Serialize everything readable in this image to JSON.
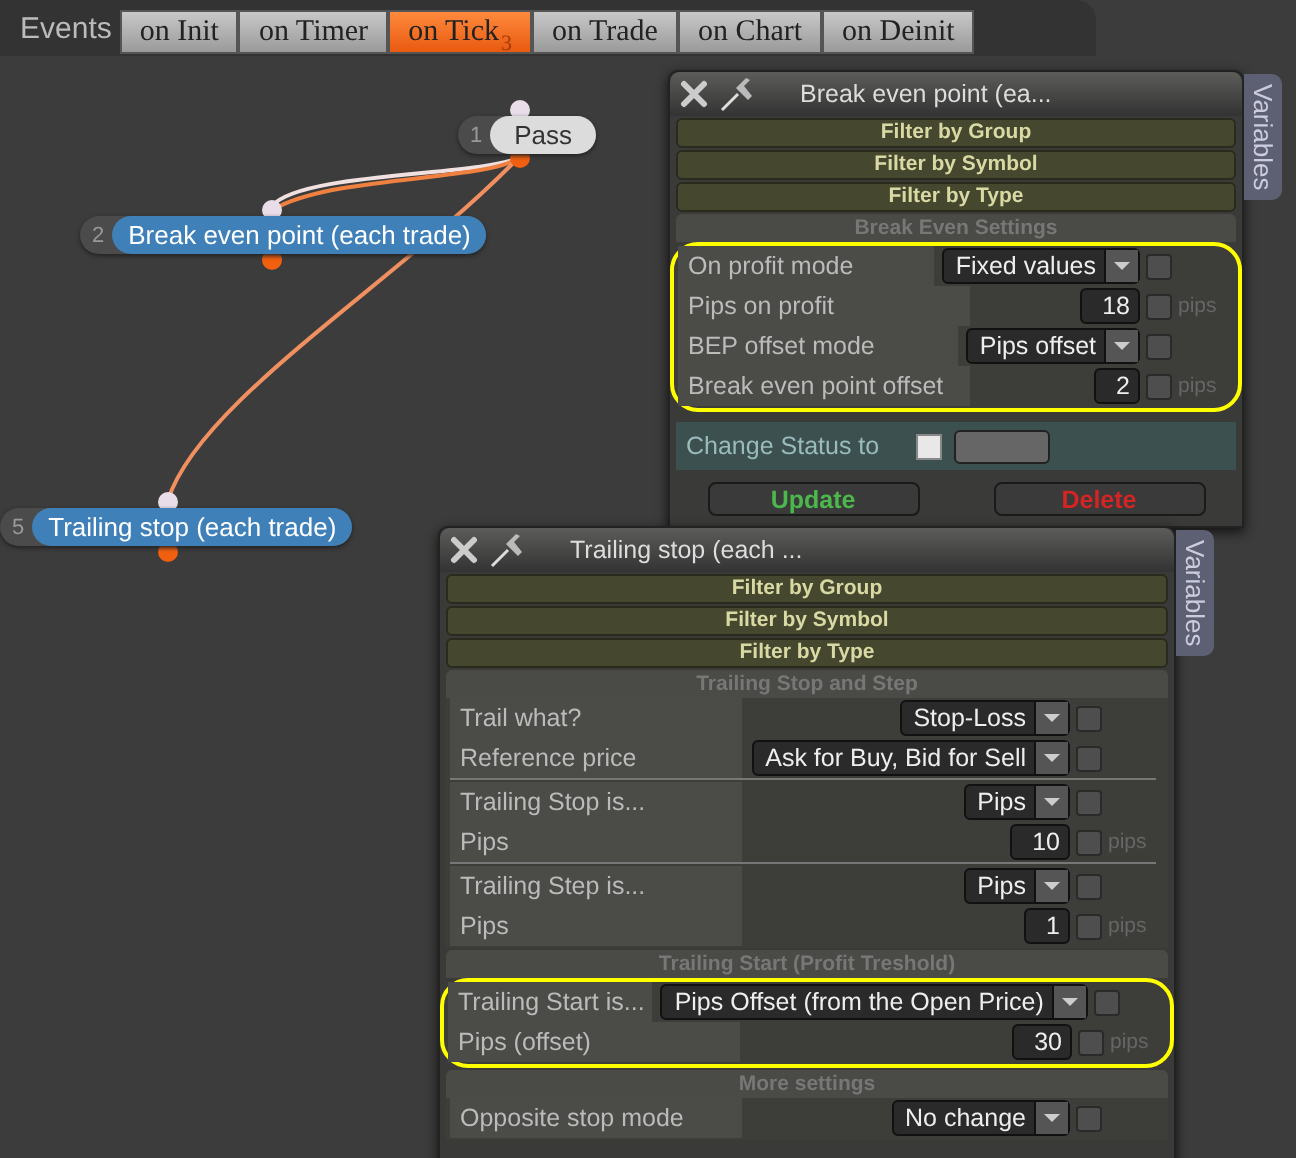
{
  "events": {
    "label": "Events",
    "tabs": [
      {
        "label": "on Init",
        "selected": false
      },
      {
        "label": "on Timer",
        "selected": false
      },
      {
        "label": "on Tick",
        "selected": true,
        "badge": "3"
      },
      {
        "label": "on Trade",
        "selected": false
      },
      {
        "label": "on Chart",
        "selected": false
      },
      {
        "label": "on Deinit",
        "selected": false
      }
    ]
  },
  "nodes": [
    {
      "number": "1",
      "label": "Pass",
      "kind": "pass"
    },
    {
      "number": "2",
      "label": "Break even point (each trade)",
      "kind": "action"
    },
    {
      "number": "5",
      "label": "Trailing stop (each trade)",
      "kind": "action"
    }
  ],
  "panels": [
    {
      "title": "Break even point (ea...",
      "side_tab": "Variables",
      "filters": [
        "Filter by Group",
        "Filter by Symbol",
        "Filter by Type"
      ],
      "sections": [
        {
          "title": "Break Even Settings",
          "highlighted": true,
          "groups": [
            [
              {
                "label": "On profit mode",
                "kind": "select",
                "value": "Fixed values",
                "checked": false
              },
              {
                "label": "Pips on profit",
                "kind": "number",
                "value": "18",
                "checked": false,
                "unit": "pips"
              },
              {
                "label": "BEP offset mode",
                "kind": "select",
                "value": "Pips offset",
                "checked": false
              },
              {
                "label": "Break even point offset",
                "kind": "number",
                "value": "2",
                "checked": false,
                "unit": "pips"
              }
            ]
          ]
        }
      ],
      "change_status": {
        "label": "Change Status to",
        "checked": false
      },
      "buttons": [
        {
          "label": "Update",
          "kind": "update"
        },
        {
          "label": "Delete",
          "kind": "delete"
        }
      ]
    },
    {
      "title": "Trailing stop (each ...",
      "side_tab": "Variables",
      "filters": [
        "Filter by Group",
        "Filter by Symbol",
        "Filter by Type"
      ],
      "sections": [
        {
          "title": "Trailing Stop and Step",
          "highlighted": false,
          "groups": [
            [
              {
                "label": "Trail what?",
                "kind": "select",
                "value": "Stop-Loss",
                "checked": false
              },
              {
                "label": "Reference price",
                "kind": "select",
                "value": "Ask for Buy, Bid for Sell",
                "checked": false
              }
            ],
            [
              {
                "label": "Trailing Stop is...",
                "kind": "select",
                "value": "Pips",
                "checked": false
              },
              {
                "label": "Pips",
                "kind": "number",
                "value": "10",
                "checked": false,
                "unit": "pips"
              }
            ],
            [
              {
                "label": "Trailing Step is...",
                "kind": "select",
                "value": "Pips",
                "checked": false
              },
              {
                "label": "Pips",
                "kind": "number",
                "value": "1",
                "checked": false,
                "unit": "pips"
              }
            ]
          ]
        },
        {
          "title": "Trailing Start (Profit Treshold)",
          "highlighted": true,
          "groups": [
            [
              {
                "label": "Trailing Start is...",
                "kind": "select",
                "value": "Pips Offset (from the Open Price)",
                "checked": false
              },
              {
                "label": "Pips (offset)",
                "kind": "number",
                "value": "30",
                "checked": false,
                "unit": "pips"
              }
            ]
          ]
        },
        {
          "title": "More settings",
          "highlighted": false,
          "groups": [
            [
              {
                "label": "Opposite stop mode",
                "kind": "select",
                "value": "No change",
                "checked": false
              }
            ]
          ]
        }
      ]
    }
  ]
}
